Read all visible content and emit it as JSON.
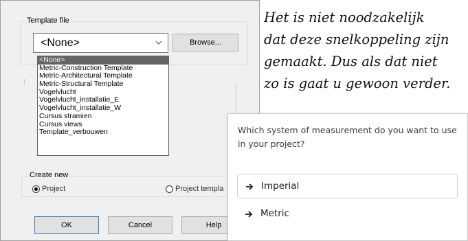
{
  "dialog": {
    "template_group_label": "Template file",
    "combo_value": "<None>",
    "browse_label": "Browse...",
    "dropdown_items": [
      "<None>",
      "Metric-Construction Template",
      "Metric-Architectural Template",
      "Metric-Structural Template",
      "Vogelvlucht",
      "Vogelvlucht_installatie_E",
      "Vogelvlucht_installatie_W",
      "Cursus stramien",
      "Cursus views",
      "Template_verbouwen"
    ],
    "selected_index": 0,
    "create_new_label": "Create new",
    "radio_project": "Project",
    "radio_project_template": "Project templa",
    "ok_label": "OK",
    "cancel_label": "Cancel",
    "help_label": "Help"
  },
  "note": {
    "lines": [
      "Het is niet noodzakelijk",
      "dat deze snelkoppeling zijn",
      "gemaakt. Dus als dat niet",
      "zo is gaat u gewoon verder."
    ]
  },
  "popup": {
    "question": "Which system of measurement do you want to use in your project?",
    "options": [
      "Imperial",
      "Metric"
    ],
    "arrow_icon": "right-arrow-icon"
  },
  "colors": {
    "dialog_bg": "#f0f0f0",
    "selection": "#646464",
    "button_bg": "#e1e1e1"
  }
}
